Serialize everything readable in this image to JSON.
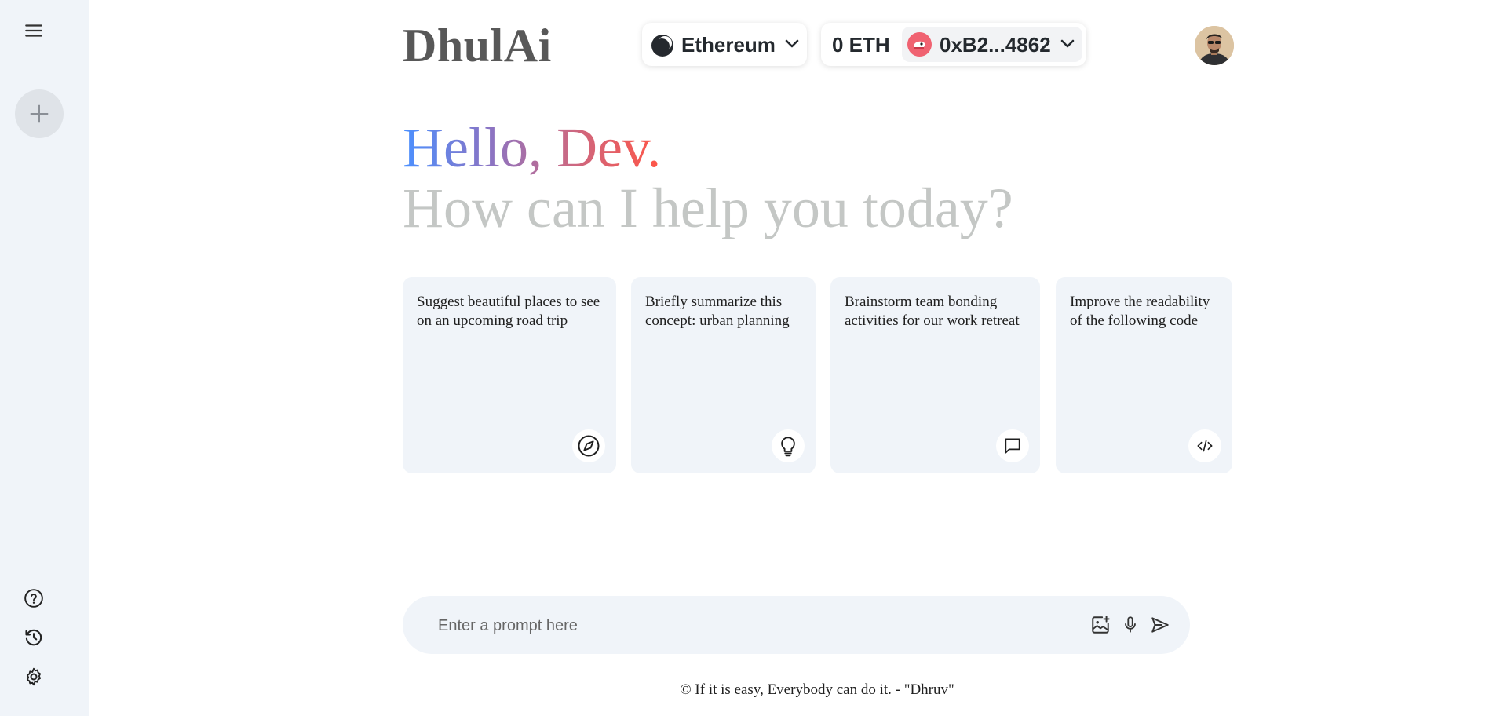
{
  "brand": {
    "name": "DhulAi"
  },
  "wallet": {
    "chain_name": "Ethereum",
    "balance": "0 ETH",
    "address": "0xB2...4862"
  },
  "greeting": {
    "hello": "Hello, Dev.",
    "subtitle": "How can I help you today?"
  },
  "cards": [
    {
      "text": "Suggest beautiful places to see on an upcoming road trip",
      "icon": "compass-icon"
    },
    {
      "text": "Briefly summarize this concept: urban planning",
      "icon": "bulb-icon"
    },
    {
      "text": "Brainstorm team bonding activities for our work retreat",
      "icon": "message-icon"
    },
    {
      "text": "Improve the readability of the following code",
      "icon": "code-icon"
    }
  ],
  "prompt": {
    "placeholder": "Enter a prompt here"
  },
  "footer": {
    "text": "© If it is easy, Everybody can do it. - \"Dhruv\""
  },
  "sidebar": {
    "icons": [
      "menu-icon",
      "plus-icon",
      "help-icon",
      "history-icon",
      "settings-icon"
    ]
  },
  "colors": {
    "sidebar_bg": "#f0f4f9",
    "card_bg": "#f0f4f9",
    "gradient": [
      "#4b90ff",
      "#ff5546"
    ],
    "subtitle": "#c4c7c5",
    "logo": "#585858"
  }
}
